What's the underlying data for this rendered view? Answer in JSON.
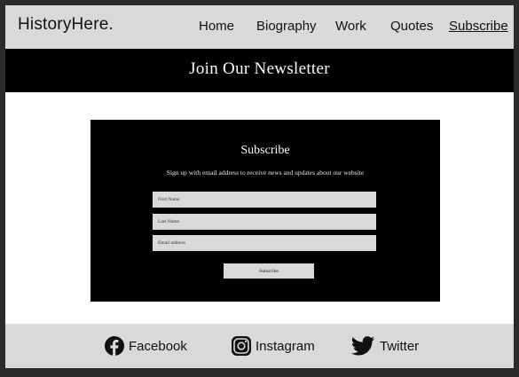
{
  "header": {
    "brand": "HistoryHere.",
    "nav": {
      "home": "Home",
      "biography": "Biography",
      "work": "Work",
      "quotes": "Quotes",
      "subscribe": "Subscribe"
    }
  },
  "banner": {
    "title": "Join Our Newsletter"
  },
  "subscribe_form": {
    "title": "Subscribe",
    "description": "Sign up with email address to receive news and updates about our website",
    "first_name_placeholder": "First Name",
    "last_name_placeholder": "Last Name",
    "email_placeholder": "Email address",
    "button_label": "Subscribe"
  },
  "footer": {
    "links": {
      "facebook": {
        "label": "Facebook",
        "icon": "facebook-icon"
      },
      "instagram": {
        "label": "Instagram",
        "icon": "instagram-icon"
      },
      "twitter": {
        "label": "Twitter",
        "icon": "twitter-icon"
      }
    }
  },
  "colors": {
    "header_bg": "#d9d9d9",
    "banner_bg": "#000000",
    "form_bg": "#000000",
    "field_bg": "#d9d9d9",
    "page_bg": "#ffffff"
  }
}
